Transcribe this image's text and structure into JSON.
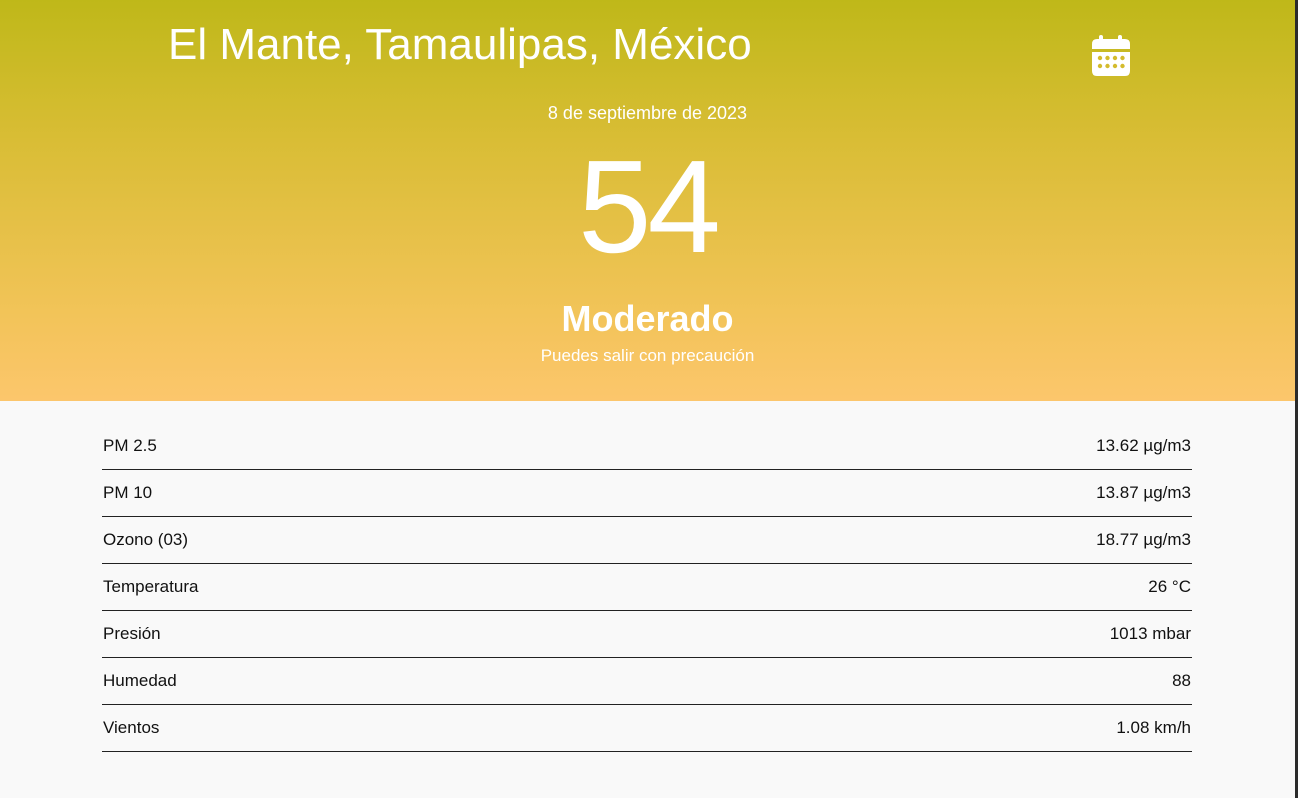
{
  "header": {
    "location": "El Mante, Tamaulipas, México",
    "calendar_icon": "calendar-icon",
    "date": "8 de septiembre de 2023",
    "aqi": "54",
    "level": "Moderado",
    "advice": "Puedes salir con precaución"
  },
  "colors": {
    "gradient_top": "#bfb819",
    "gradient_bottom": "#fcc66c",
    "text_on_hero": "#ffffff",
    "body_background": "#f9f9f9"
  },
  "metrics": [
    {
      "label": "PM 2.5",
      "value": "13.62 µg/m3"
    },
    {
      "label": "PM 10",
      "value": "13.87 µg/m3"
    },
    {
      "label": "Ozono (03)",
      "value": "18.77 µg/m3"
    },
    {
      "label": "Temperatura",
      "value": "26 °C"
    },
    {
      "label": "Presión",
      "value": "1013 mbar"
    },
    {
      "label": "Humedad",
      "value": "88"
    },
    {
      "label": "Vientos",
      "value": "1.08 km/h"
    }
  ]
}
